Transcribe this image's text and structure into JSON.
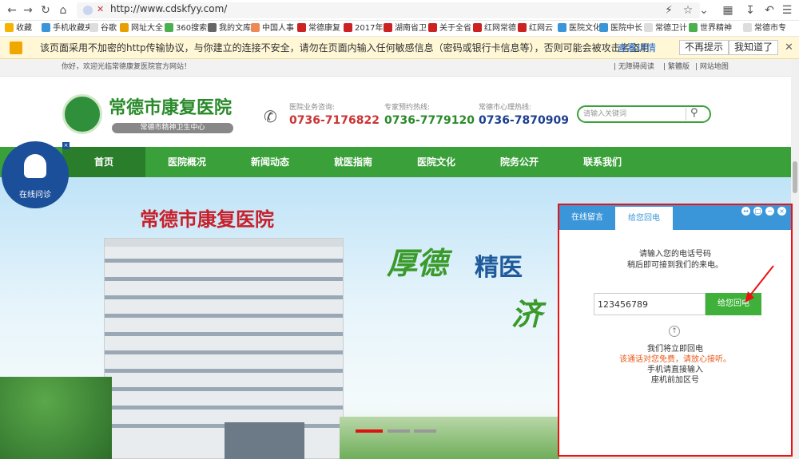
{
  "browser": {
    "url": "http://www.cdskfyy.com/",
    "bookmarks": [
      "收藏",
      "手机收藏夹",
      "谷歌",
      "网址大全",
      "360搜索",
      "我的文库",
      "中国人事",
      "常德康复",
      "2017年",
      "湖南省卫",
      "关于全省",
      "红网常德",
      "红网云",
      "医院文化",
      "医院中长",
      "常德卫计",
      "世界精神",
      "常德市专"
    ]
  },
  "security_warning": {
    "text": "该页面采用不加密的http传输协议，与你建立的连接不安全，请勿在页面内输入任何敏感信息（密码或银行卡信息等），否则可能会被攻击者盗用",
    "details_link": "查看详情",
    "no_remind": "不再提示",
    "got_it": "我知道了"
  },
  "site": {
    "welcome": "你好，欢迎光临常德康复医院官方网站！",
    "top_links": [
      "无障碍阅读",
      "繁體版",
      "网站地图"
    ],
    "logo_title": "常德市康复医院",
    "logo_subtitle": "常德市精神卫生中心",
    "hotlines": [
      {
        "label": "医院业务咨询:",
        "number": "0736-7176822"
      },
      {
        "label": "专家预约热线:",
        "number": "0736-7779120"
      },
      {
        "label": "常德市心理热线:",
        "number": "0736-7870909"
      }
    ],
    "search_placeholder": "请输入关键词",
    "nav": [
      "首页",
      "医院概况",
      "新闻动态",
      "就医指南",
      "医院文化",
      "院务公开",
      "联系我们"
    ],
    "hero_title": "常德市康复医院",
    "hero_slogan_1": "厚德",
    "hero_slogan_2": "精医",
    "hero_slogan_3": "济",
    "online_consult": "在线问诊"
  },
  "chat": {
    "tabs": [
      "在线留言",
      "给您回电"
    ],
    "active_tab": "给您回电",
    "prompt_1": "请输入您的电话号码",
    "prompt_2": "稍后即可接到我们的来电。",
    "phone_value": "123456789",
    "callback_button": "给您回电",
    "info_1": "我们将立即回电",
    "info_2": "该通话对您免费，请放心接听。",
    "info_3": "手机请直接输入",
    "info_4": "座机前加区号"
  },
  "colors": {
    "brand_green": "#3aa03a",
    "nav_active": "#2a7d2a",
    "hotline_blue": "#1c3f8f",
    "chat_blue": "#3a96d8",
    "alert_red": "#e11"
  }
}
